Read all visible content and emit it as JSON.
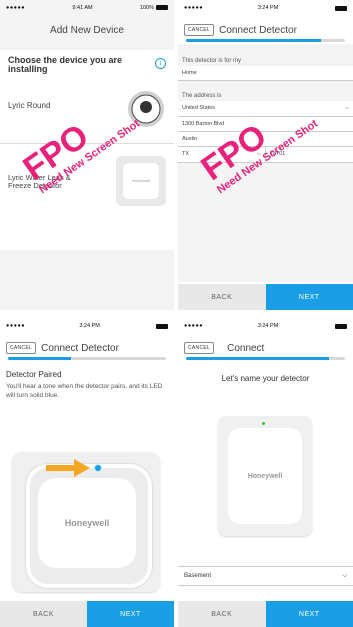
{
  "screen1": {
    "status": {
      "signal": "●●●●● ",
      "time": "9:41 AM",
      "battery": "100%"
    },
    "title": "Add New Device",
    "heading": "Choose the device you are installing",
    "devices": [
      {
        "label": "Lyric Round"
      },
      {
        "label": "Lyric Water Leak & Freeze Detector",
        "brand": "Honeywell"
      }
    ],
    "fpo": {
      "big": "FPO",
      "small": "Need New Screen Shot"
    }
  },
  "screen2": {
    "status": {
      "signal": "●●●●● ",
      "time": "3:24 PM"
    },
    "cancel": "CANCEL",
    "title": "Connect Detector",
    "progress_fraction": 0.85,
    "for_label": "This detector is for my",
    "for_value": "Home",
    "address_label": "The address is",
    "country": "United States",
    "street": "1300 Barton Blvd",
    "city": "Austin",
    "state": "TX",
    "zip": "78701",
    "back": "BACK",
    "next": "NEXT",
    "fpo": {
      "big": "FPO",
      "small": "Need New Screen Shot"
    }
  },
  "screen3": {
    "status": {
      "signal": "●●●●● ",
      "time": "3:24 PM"
    },
    "cancel": "CANCEL",
    "title": "Connect Detector",
    "progress_fraction": 0.4,
    "heading": "Detector Paired",
    "body": "You'll hear a tone when the detector pairs, and its LED will turn solid blue.",
    "brand": "Honeywell",
    "back": "BACK",
    "next": "NEXT"
  },
  "screen4": {
    "status": {
      "signal": "●●●●● ",
      "time": "3:24 PM"
    },
    "cancel": "CANCEL",
    "title": "Connect",
    "progress_fraction": 0.9,
    "heading": "Let's name your detector",
    "brand": "Honeywell",
    "name_value": "Basement",
    "back": "BACK",
    "next": "NEXT"
  },
  "colors": {
    "accent": "#1a9ee6",
    "fpo": "#e8227a",
    "arrow": "#f5a623"
  }
}
